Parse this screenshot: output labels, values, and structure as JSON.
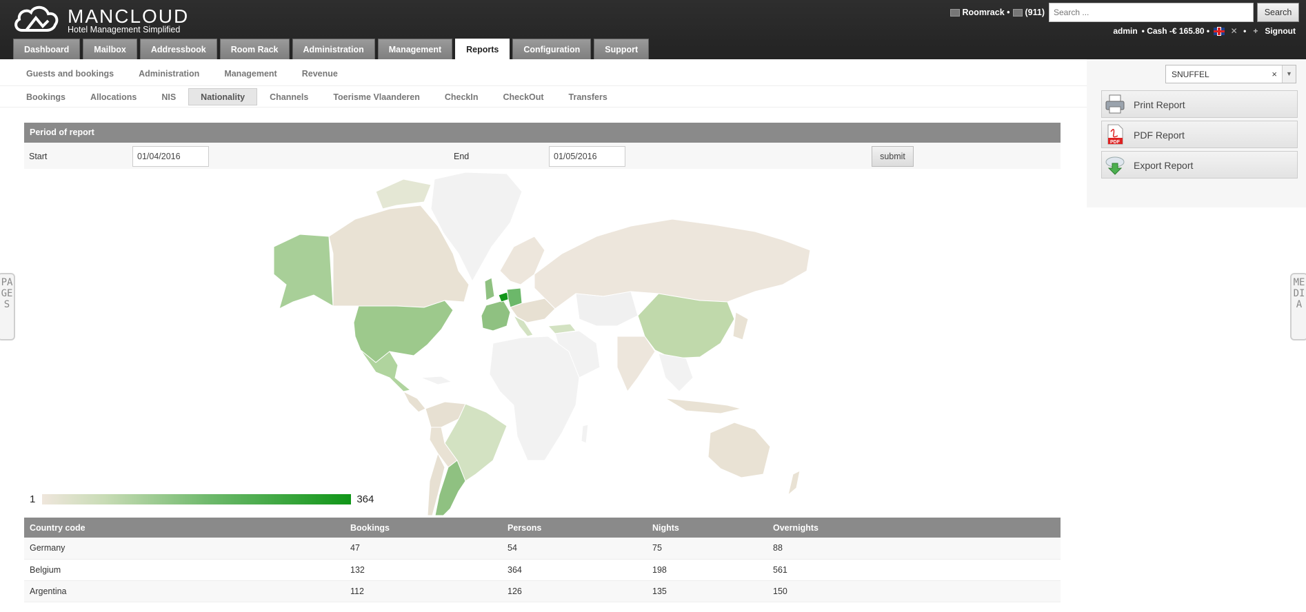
{
  "brand": {
    "name": "MANCLOUD",
    "tagline": "Hotel Management Simplified"
  },
  "header": {
    "roomrack": "Roomrack •",
    "messages": "(911)",
    "search_placeholder": "Search ...",
    "search_button": "Search",
    "user": "admin",
    "cash": "• Cash -€ 165.80 •",
    "sep1": "•",
    "sep2": "•",
    "signout": "Signout"
  },
  "main_nav": [
    "Dashboard",
    "Mailbox",
    "Addressbook",
    "Room Rack",
    "Administration",
    "Management",
    "Reports",
    "Configuration",
    "Support"
  ],
  "main_nav_active": "Reports",
  "sub_nav": [
    "Guests and bookings",
    "Administration",
    "Management",
    "Revenue"
  ],
  "report_tabs": [
    "Bookings",
    "Allocations",
    "NIS",
    "Nationality",
    "Channels",
    "Toerisme Vlaanderen",
    "CheckIn",
    "CheckOut",
    "Transfers"
  ],
  "report_tabs_active": "Nationality",
  "period": {
    "header": "Period of report",
    "start_label": "Start",
    "start_value": "01/04/2016",
    "end_label": "End",
    "end_value": "01/05/2016",
    "submit": "submit"
  },
  "legend": {
    "min": "1",
    "max": "364",
    "colors": [
      "#efe6dc",
      "#109618"
    ]
  },
  "table": {
    "headers": [
      "Country code",
      "Bookings",
      "Persons",
      "Nights",
      "Overnights"
    ],
    "rows": [
      [
        "Germany",
        "47",
        "54",
        "75",
        "88"
      ],
      [
        "Belgium",
        "132",
        "364",
        "198",
        "561"
      ],
      [
        "Argentina",
        "112",
        "126",
        "135",
        "150"
      ]
    ]
  },
  "right_panel": {
    "hotel_select_value": "SNUFFEL",
    "clear_symbol": "×",
    "arrow_symbol": "▼",
    "buttons": [
      {
        "label": "Print Report",
        "icon": "printer-icon"
      },
      {
        "label": "PDF Report",
        "icon": "pdf-icon"
      },
      {
        "label": "Export Report",
        "icon": "export-icon"
      }
    ]
  },
  "side_tabs": {
    "left": "PAGES",
    "right": "MEDIA"
  },
  "colors": {
    "topbar": "#2b2b2b",
    "header_gray": "#8a8a8a",
    "map_max": "#109618",
    "map_min": "#efe6dc"
  }
}
